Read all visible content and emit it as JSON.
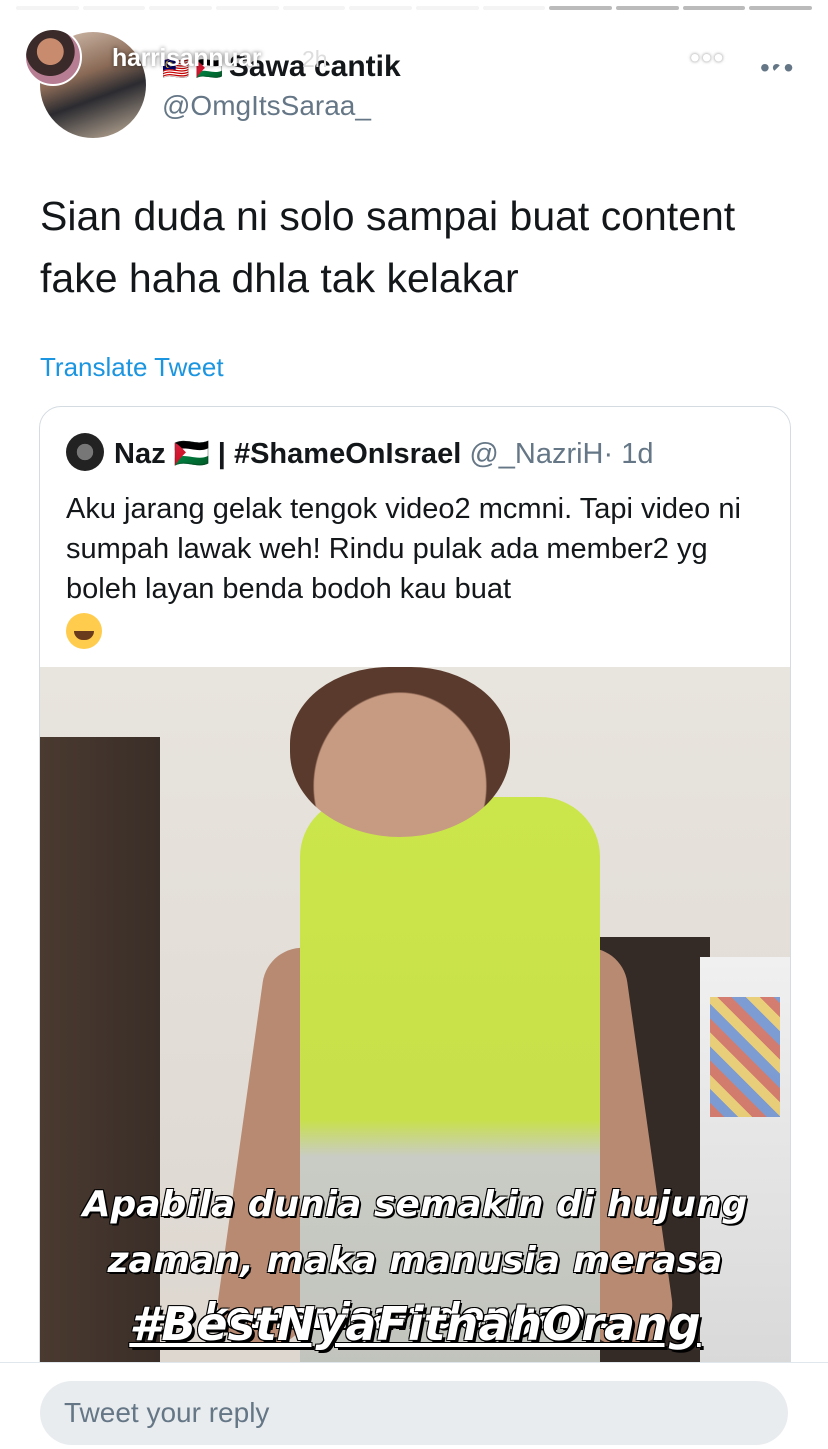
{
  "story": {
    "username": "harrisannuar",
    "time": "2h",
    "more_label": "•••",
    "close_label": "close"
  },
  "tweet": {
    "author_name": "Sawa cantik",
    "author_flags": "🇲🇾 🇵🇸",
    "author_handle": "@OmgItsSaraa_",
    "more_label": "•••",
    "text": "Sian duda ni solo sampai buat content fake haha dhla tak kelakar",
    "translate_label": "Translate Tweet"
  },
  "quoted": {
    "name": "Naz 🇵🇸 | #ShameOnIsrael",
    "handle": "@_NazriH",
    "time": "· 1d",
    "text": "Aku jarang gelak tengok video2 mcmni. Tapi video ni sumpah lawak weh! Rindu pulak ada member2 yg boleh layan benda bodoh kau buat",
    "media": {
      "caption": "Apabila dunia semakin di hujung zaman, maka manusia merasa kemanisan dengan...",
      "hashtag": "#BestNyaFitnahOrang"
    }
  },
  "reply": {
    "placeholder": "Tweet your reply"
  },
  "progress_segments": 12,
  "colors": {
    "link": "#1b95e0",
    "secondary_text": "#657786",
    "shirt": "#cbe64a"
  }
}
